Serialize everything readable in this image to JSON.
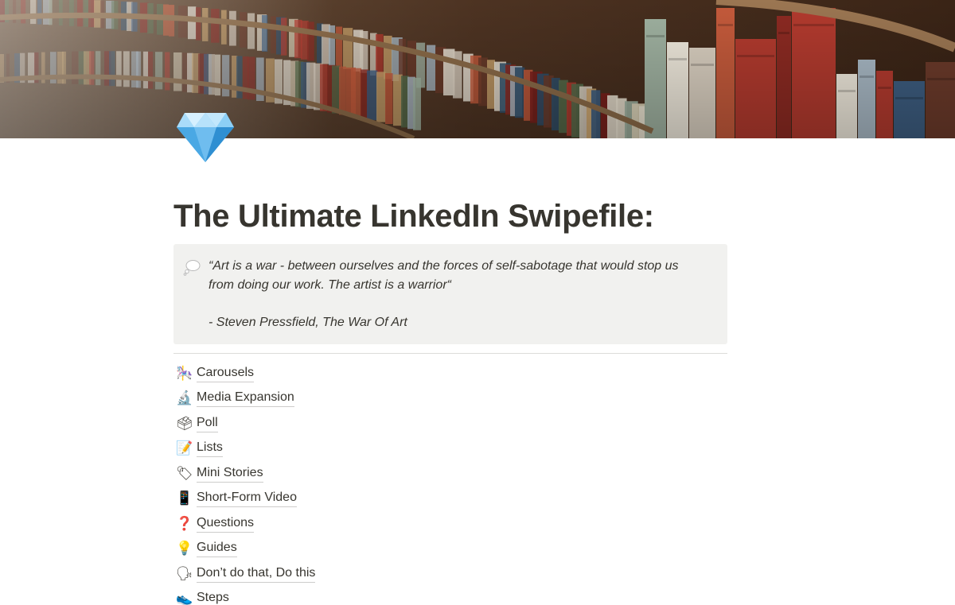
{
  "cover": {
    "image": "library-bookshelves"
  },
  "page_icon": "gem-diamond-icon",
  "title": "The Ultimate LinkedIn Swipefile:",
  "callout": {
    "icon": "thought-balloon-icon",
    "quote_line1": "“Art is a war - between ourselves and the forces of self-sabotage that would stop us",
    "quote_line2": "from doing our work. The artist is a warrior“",
    "attribution": "- Steven Pressfield, The War Of Art"
  },
  "links": [
    {
      "icon": "carousel-horse-icon",
      "glyph": "🎠",
      "label": "Carousels"
    },
    {
      "icon": "microscope-icon",
      "glyph": "🔬",
      "label": "Media Expansion"
    },
    {
      "icon": "ballot-box-icon",
      "glyph": "🗳",
      "label": "Poll"
    },
    {
      "icon": "memo-icon",
      "glyph": "📝",
      "label": "Lists"
    },
    {
      "icon": "label-tag-icon",
      "glyph": "🏷",
      "label": "Mini Stories"
    },
    {
      "icon": "mobile-phone-icon",
      "glyph": "📱",
      "label": "Short-Form Video"
    },
    {
      "icon": "question-mark-icon",
      "glyph": "❓",
      "label": "Questions"
    },
    {
      "icon": "light-bulb-icon",
      "glyph": "💡",
      "label": "Guides"
    },
    {
      "icon": "speaking-head-icon",
      "glyph": "🗣",
      "label": "Don’t do that, Do this"
    },
    {
      "icon": "footprints-icon",
      "glyph": "👟",
      "label": "Steps"
    }
  ]
}
